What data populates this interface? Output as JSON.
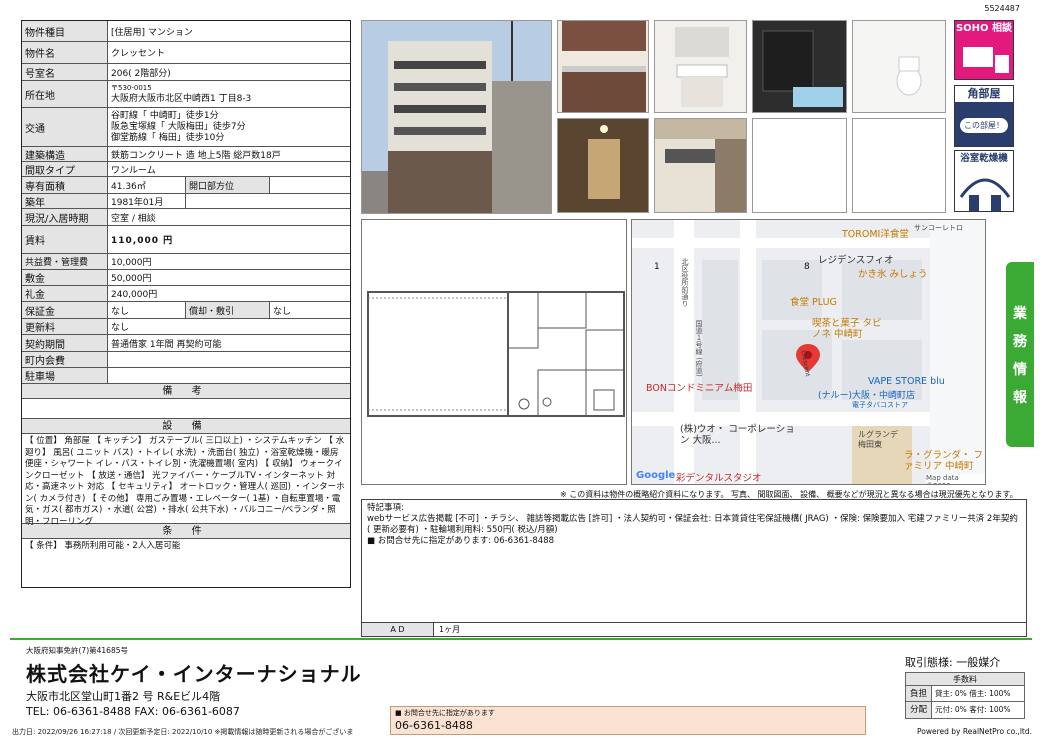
{
  "doc_id": "5524487",
  "property": {
    "type_label": "物件種目",
    "type_value": "[住居用] マンション",
    "name_label": "物件名",
    "name_value": "クレッセント",
    "room_label": "号室名",
    "room_value": "206( 2階部分)",
    "address_label": "所在地",
    "postal": "〒530-0015",
    "address": "大阪府大阪市北区中崎西1 丁目8-3",
    "transport_label": "交通",
    "transport": [
      "谷町線「 中崎町」徒歩1分",
      "阪急宝塚線「 大阪梅田」徒歩7分",
      "御堂筋線「 梅田」徒歩10分"
    ],
    "structure_label": "建築構造",
    "structure_value": "鉄筋コンクリート 造  地上5階  総戸数18戸",
    "layout_label": "間取タイプ",
    "layout_value": "ワンルーム",
    "area_label": "専有面積",
    "area_value": "41.36㎡",
    "direction_label": "開口部方位",
    "direction_value": "",
    "built_label": "築年",
    "built_value": "1981年01月",
    "status_label": "現況/入居時期",
    "status_value": "空室 / 相談",
    "rent_label": "賃料",
    "rent_value": "110,000 円",
    "common_label": "共益費・管理費",
    "common_value": "10,000円",
    "deposit_label": "敷金",
    "deposit_value": "50,000円",
    "key_label": "礼金",
    "key_value": "240,000円",
    "guarantee_label": "保証金",
    "guarantee_value": "なし",
    "amort_label": "償却・敷引",
    "amort_value": "なし",
    "renewal_label": "更新料",
    "renewal_value": "なし",
    "contract_label": "契約期間",
    "contract_value": "普通借家 1年間 再契約可能",
    "town_label": "町内会費",
    "town_value": "",
    "parking_label": "駐車場",
    "parking_value": ""
  },
  "sections": {
    "remarks_title": "備 考",
    "equipment_title": "設 備",
    "equipment_text": "【 位置】 角部屋 【 キッチン】 ガステーブル( 三口以上) ・システムキッチン 【 水廻り】 風呂( ユニット バス) ・トイレ( 水洗) ・洗面台( 独立) ・浴室乾燥機・暖房便座・シャワート イレ・バス・トイレ別・洗濯機置場( 室内) 【 収納】 ウォークインクローゼット 【 放送・通信】 光ファイバー・ケーブルTV・インターネット 対応・高速ネット 対応 【 セキュリティ】 オートロック・管理人( 巡回) ・インターホン( カメラ付き) 【 その他】 専用ごみ置場・エレベーター( 1基) ・自転車置場・電気・ガス( 都市ガス) ・水道( 公営) ・排水( 公共下水) ・バルコニー/ベランダ・照明・フローリング",
    "conditions_title": "条 件",
    "conditions_text": "【 条件】 事務所利用可能・2人入居可能"
  },
  "badges": {
    "soho": "SOHO 相談",
    "corner": "角部屋",
    "corner_sub": "この部屋！",
    "bath": "浴室乾燥機"
  },
  "map": {
    "labels": [
      "TOROMI洋食堂",
      "サンコーレトロ",
      "レジデンスフィオ",
      "かき氷 みしょう",
      "食堂 PLUG",
      "喫茶と菓子 タビノネ 中崎町",
      "BONコンドミニアム梅田",
      "VAPE STORE blu",
      "(ナルー)大阪・中崎町店",
      "電子タバコストア",
      "(株)ウオ・ コーポレーション 大阪...",
      "ルグランデ 梅田東",
      "ラ・グランダ・ ファミリア 中崎町",
      "彩デンタルスタジオ",
      "Crescent",
      "Map data ©2022",
      "1",
      "8",
      "Google"
    ],
    "street_v": "北区役所前通り",
    "street_v2": "国道１号線 (府道)"
  },
  "side_tab": [
    "業",
    "務",
    "情",
    "報"
  ],
  "disclaimer": "※ この資料は物件の概略紹介資料になります。 写真、 間取図面、 設備、 概要などが現況と異なる場合は現況優先となります。",
  "notes": {
    "title": "特記事項:",
    "line1": "webサービス広告掲載 [不可] ・チラシ、 雑誌等掲載広告 [許可] ・法人契約可・保証会社: 日本賃貸住宅保証機構( JRAG) ・保険: 保険要加入 宅建ファミリー共済 2年契約( 更新必要有) ・駐輪場利用料: 550円( 税込/月額)",
    "line2": "■ お問合せ先に指定があります: 06-6361-8488",
    "ad_label": "A D",
    "ad_value": "1ヶ月"
  },
  "company": {
    "license": "大阪府知事免許(7)第41685号",
    "name": "株式会社ケイ・インターナショナル",
    "address": "大阪市北区堂山町1番2 号   R&Eビル4階",
    "tel": "TEL:  06-6361-8488  FAX:  06-6361-6087"
  },
  "deal": {
    "title": "取引態様:  一般媒介",
    "fee_header": "手数料",
    "rows": [
      {
        "k": "負担",
        "v": "貸主: 0%  借主: 100%"
      },
      {
        "k": "分配",
        "v": "元付: 0%  客付: 100%"
      }
    ]
  },
  "contact": {
    "label": "■ お問合せ先に指定があります",
    "tel": "06-6361-8488"
  },
  "footer": {
    "left": "出力日: 2022/09/26 16:27:18 / 次回更新予定日: 2022/10/10 ※掲載情報は随時更新される場合がございま",
    "right": "Powered by RealNetPro co.,ltd."
  },
  "colors": {
    "green": "#3aaa35",
    "soho": "#e4197e",
    "badge_blue": "#2a3d6c"
  }
}
